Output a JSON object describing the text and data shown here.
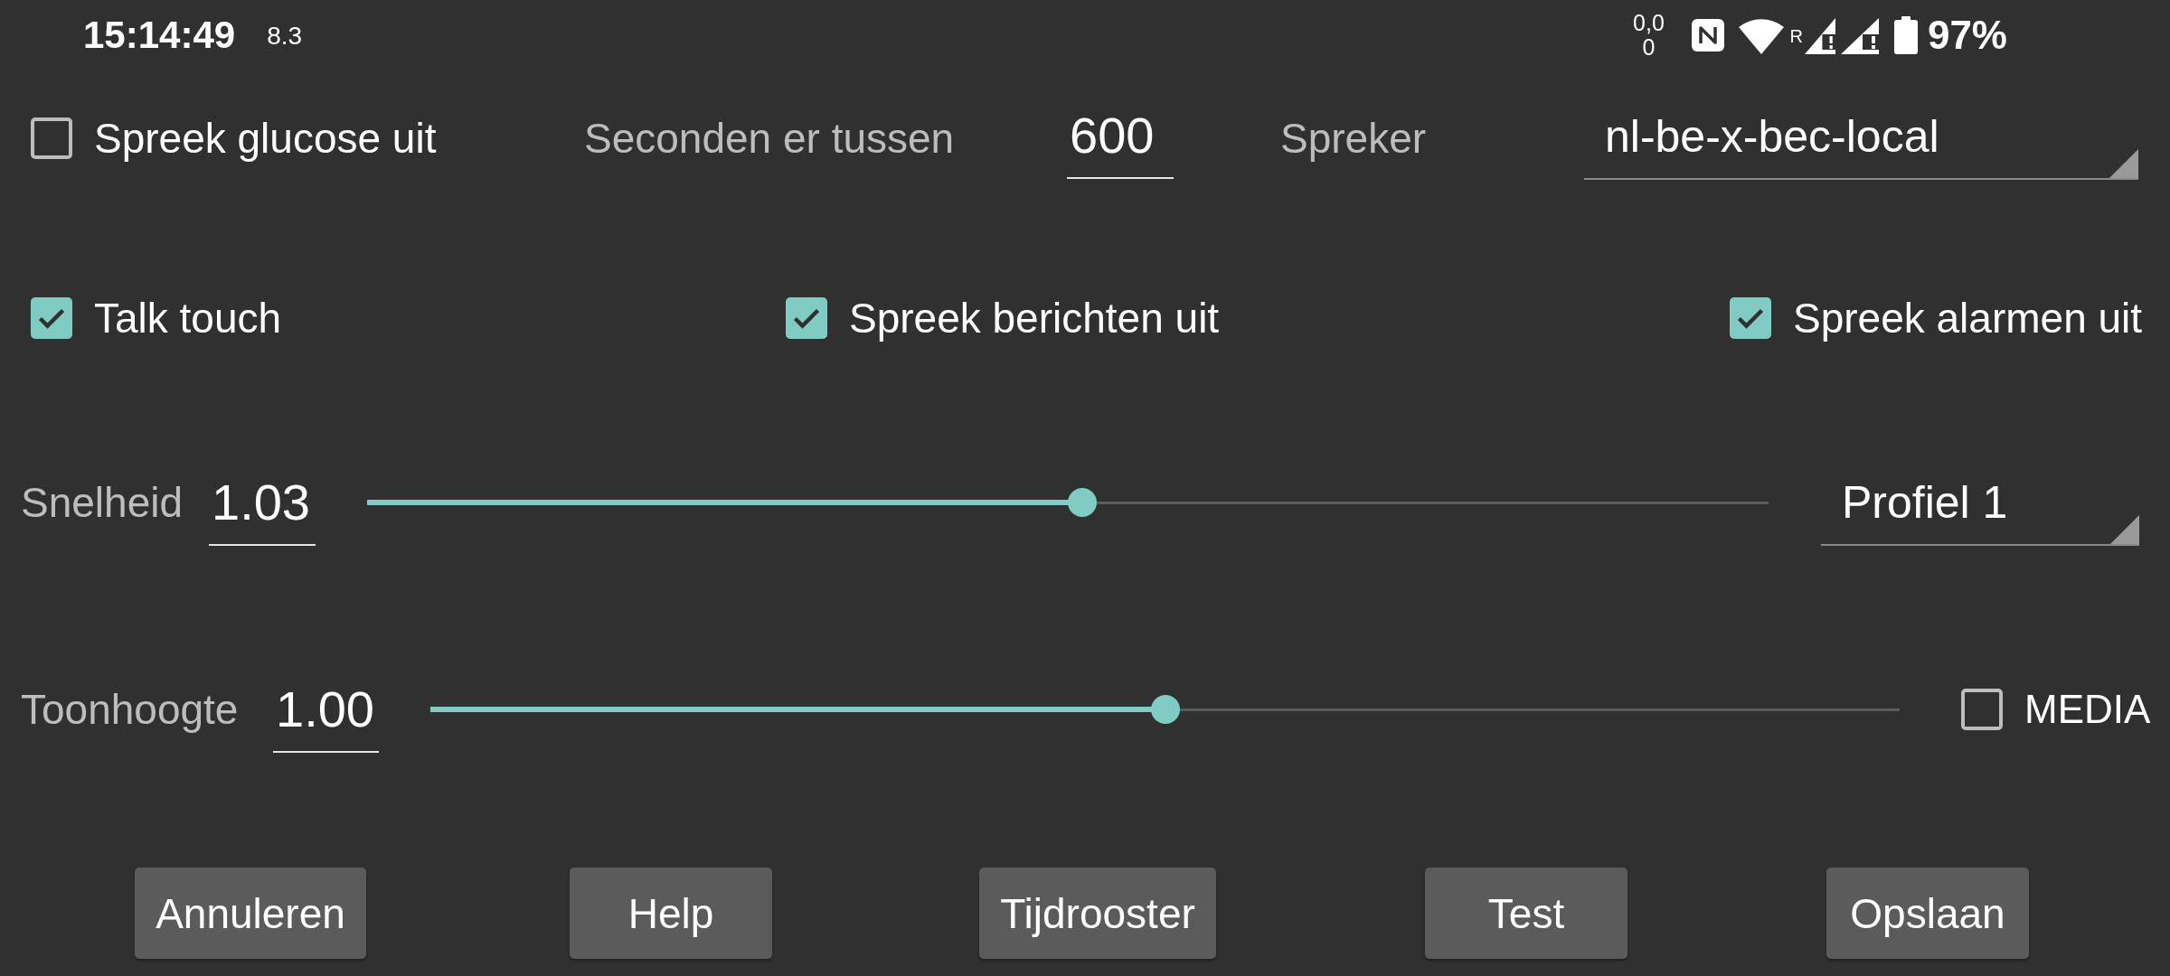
{
  "status_bar": {
    "time": "15:14:49",
    "note": "8.3",
    "indicator": "0,0 0",
    "roaming": "R",
    "battery_text": "97%"
  },
  "speech": {
    "speak_glucose": {
      "label": "Spreek glucose uit",
      "checked": false
    },
    "interval": {
      "label": "Seconden er tussen",
      "value": "600"
    },
    "speaker": {
      "label": "Spreker",
      "value": "nl-be-x-bec-local"
    }
  },
  "options": [
    {
      "label": "Talk touch",
      "checked": true
    },
    {
      "label": "Spreek berichten uit",
      "checked": true
    },
    {
      "label": "Spreek alarmen uit",
      "checked": true
    }
  ],
  "speed": {
    "label": "Snelheid",
    "value": "1.03",
    "level": 0.51,
    "profile": "Profiel 1"
  },
  "pitch": {
    "label": "Toonhoogte",
    "value": "1.00",
    "level": 0.5,
    "media": {
      "label": "MEDIA",
      "checked": false
    }
  },
  "buttons": [
    "Annuleren",
    "Help",
    "Tijdrooster",
    "Test",
    "Opslaan"
  ]
}
